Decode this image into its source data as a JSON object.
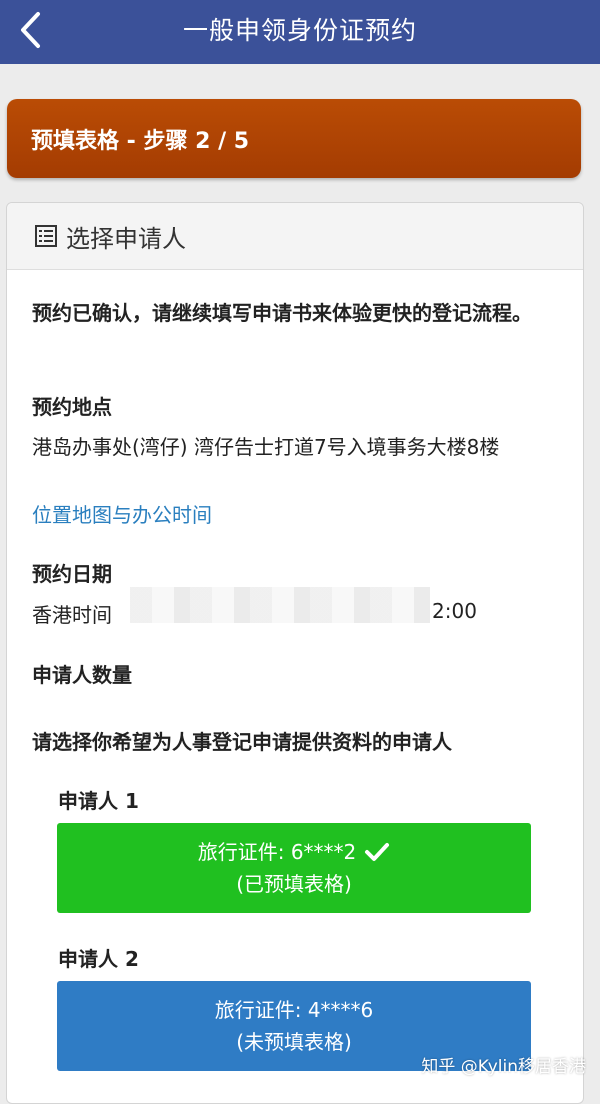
{
  "header": {
    "title": "一般申领身份证预约",
    "back_icon": "chevron-left-icon"
  },
  "step": {
    "label": "预填表格 - 步骤 2 / 5"
  },
  "card": {
    "header_icon": "list-icon",
    "header_title": "选择申请人",
    "confirm_text": "预约已确认，请继续填写申请书来体验更快的登记流程。",
    "location_label": "预约地点",
    "location_value": "港岛办事处(湾仔) 湾仔告士打道7号入境事务大楼8楼",
    "location_link": "位置地图与办公时间",
    "date_label": "预约日期",
    "date_prefix": "香港时间",
    "date_suffix": "2:00",
    "count_label": "申请人数量",
    "instruction": "请选择你希望为人事登记申请提供资料的申请人",
    "applicants": [
      {
        "label": "申请人 1",
        "doc": "旅行证件: 6****2",
        "status": "(已预填表格)",
        "completed": true
      },
      {
        "label": "申请人 2",
        "doc": "旅行证件: 4****6",
        "status": "(未预填表格)",
        "completed": false
      }
    ]
  },
  "watermark": "知乎 @Kylin移居香港",
  "colors": {
    "header_bg": "#3b5199",
    "step_bar": "#b04504",
    "completed_button": "#20c020",
    "pending_button": "#2f7cc5",
    "link": "#2a7fbf"
  }
}
